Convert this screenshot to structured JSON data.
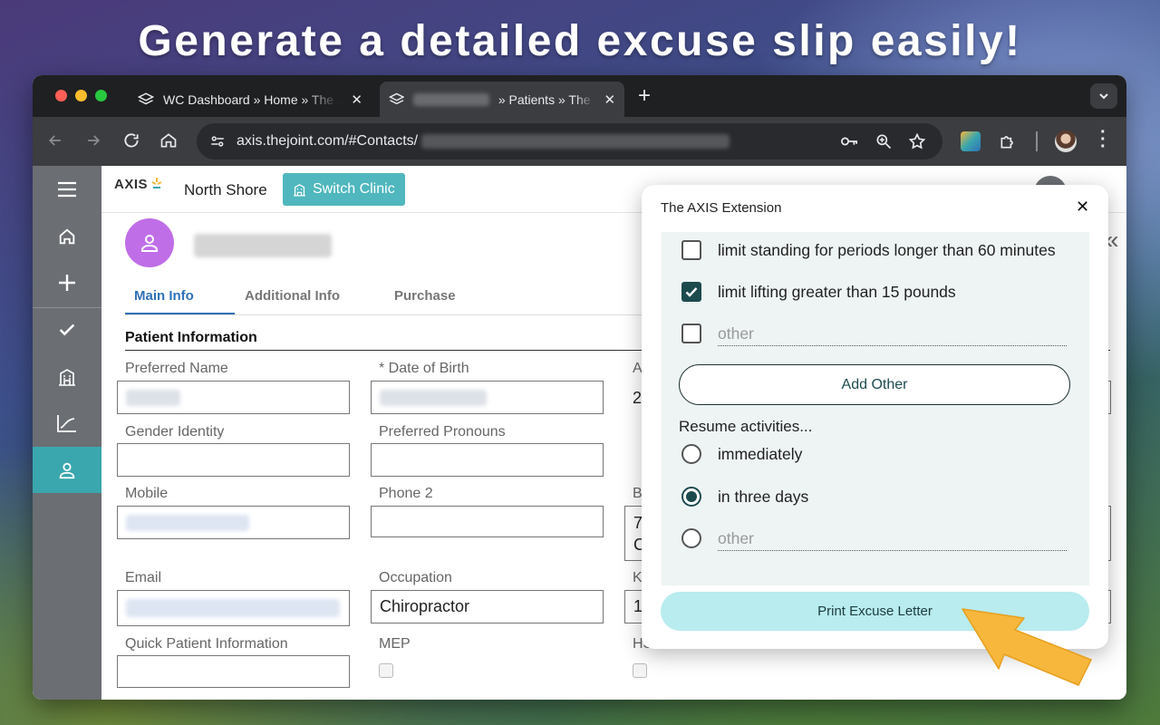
{
  "headline": "Generate a detailed excuse slip easily!",
  "colors": {
    "accent": "#3aa6ad",
    "brand_teal": "#1c4b4e",
    "avatar": "#c06ee8",
    "print_button": "#b8ecef",
    "arrow": "#f6b73c",
    "tab_underline": "#2f72b8"
  },
  "browser": {
    "tabs": [
      {
        "title": "WC Dashboard » Home » The Joint",
        "close": "✕"
      },
      {
        "title": "» Patients » The Joint",
        "close": "✕"
      }
    ],
    "new_tab": "+",
    "url_prefix": "axis.thejoint.com/#Contacts/"
  },
  "app": {
    "logo": "AXIS",
    "clinic": "North Shore",
    "switch_clinic": "Switch Clinic",
    "rail": [
      "menu-icon",
      "home-icon",
      "plus-icon",
      "check-icon",
      "building-icon",
      "chart-icon",
      "user-icon"
    ],
    "tabs": [
      "Main Info",
      "Additional Info",
      "Purchase"
    ],
    "section_title": "Patient Information",
    "fields": {
      "preferred_name": {
        "label": "Preferred Name",
        "value": ""
      },
      "dob": {
        "label": "* Date of Birth",
        "value": ""
      },
      "age": {
        "label": "A",
        "value": "2"
      },
      "gender": {
        "label": "Gender Identity",
        "value": ""
      },
      "pronouns": {
        "label": "Preferred Pronouns",
        "value": ""
      },
      "mobile": {
        "label": "Mobile",
        "value": ""
      },
      "phone2": {
        "label": "Phone 2",
        "value": ""
      },
      "address": {
        "label": "B",
        "value1": "7",
        "value2": "C"
      },
      "email": {
        "label": "Email",
        "value": ""
      },
      "occupation": {
        "label": "Occupation",
        "value": "Chiropractor"
      },
      "k_field": {
        "label": "K",
        "value": "1"
      },
      "quick_info": {
        "label": "Quick Patient Information",
        "value": ""
      },
      "mep": {
        "label": "MEP"
      },
      "hs": {
        "label": "HS"
      }
    }
  },
  "popup": {
    "title": "The AXIS Extension",
    "close": "✕",
    "restrictions": [
      {
        "label": "limit standing for periods longer than 60 minutes",
        "checked": false
      },
      {
        "label": "limit lifting greater than 15 pounds",
        "checked": true
      }
    ],
    "other_placeholder": "other",
    "add_other": "Add Other",
    "resume_label": "Resume activities...",
    "resume_options": [
      {
        "label": "immediately",
        "selected": false
      },
      {
        "label": "in three days",
        "selected": true
      }
    ],
    "resume_other_placeholder": "other",
    "print_button": "Print Excuse Letter"
  },
  "collapse_glyph": "«"
}
